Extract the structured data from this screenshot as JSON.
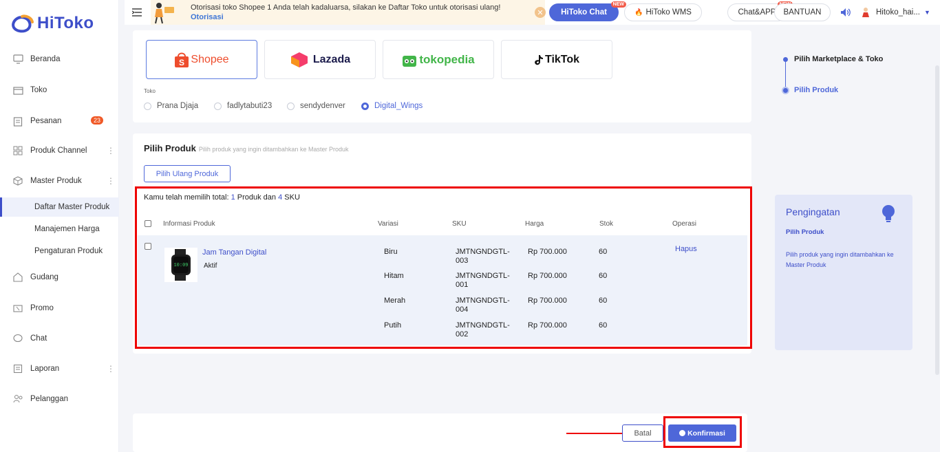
{
  "brand": {
    "name": "HiToko"
  },
  "sidebar": {
    "items": [
      {
        "label": "Beranda"
      },
      {
        "label": "Toko"
      },
      {
        "label": "Pesanan",
        "badge": "23"
      },
      {
        "label": "Produk Channel"
      },
      {
        "label": "Master Produk"
      },
      {
        "label": "Gudang"
      },
      {
        "label": "Promo"
      },
      {
        "label": "Chat"
      },
      {
        "label": "Laporan"
      },
      {
        "label": "Pelanggan"
      }
    ],
    "sub_items": [
      {
        "label": "Daftar Master Produk"
      },
      {
        "label": "Manajemen Harga"
      },
      {
        "label": "Pengaturan Produk"
      }
    ]
  },
  "topbar": {
    "menu_letter": "M",
    "notice_text": "Otorisasi toko Shopee 1 Anda telah kadaluarsa, silakan ke Daftar Toko untuk otorisasi ulang!",
    "notice_link": "Otorisasi",
    "hitoko_chat": "HiToko Chat",
    "new_tag": "NEW",
    "hitoko_wms": "HiToko WMS",
    "chat_app": "Chat&APP",
    "bantuan": "BANTUAN",
    "username": "Hitoko_hai..."
  },
  "marketplaces": [
    {
      "name": "Shopee"
    },
    {
      "name": "Lazada"
    },
    {
      "name": "tokopedia"
    },
    {
      "name": "TikTok"
    }
  ],
  "toko": {
    "label": "Toko",
    "options": [
      "Prana Djaja",
      "fadlytabuti23",
      "sendydenver",
      "Digital_Wings"
    ],
    "selected": "Digital_Wings"
  },
  "pilih_produk": {
    "title": "Pilih Produk",
    "hint": "Pilih produk yang ingin ditambahkan ke Master Produk",
    "reselect_label": "Pilih Ulang Produk",
    "summary_prefix": "Kamu telah memilih total:",
    "summary_products": "1",
    "summary_mid": "Produk dan",
    "summary_sku": "4",
    "summary_suffix": "SKU",
    "columns": [
      "Informasi Produk",
      "Variasi",
      "SKU",
      "Harga",
      "Stok",
      "Operasi"
    ],
    "product": {
      "name": "Jam Tangan Digital",
      "status": "Aktif",
      "operation": "Hapus",
      "variants": [
        {
          "variasi": "Biru",
          "sku": "JMTNGNDGTL-003",
          "harga": "Rp 700.000",
          "stok": "60"
        },
        {
          "variasi": "Hitam",
          "sku": "JMTNGNDGTL-001",
          "harga": "Rp 700.000",
          "stok": "60"
        },
        {
          "variasi": "Merah",
          "sku": "JMTNGNDGTL-004",
          "harga": "Rp 700.000",
          "stok": "60"
        },
        {
          "variasi": "Putih",
          "sku": "JMTNGNDGTL-002",
          "harga": "Rp 700.000",
          "stok": "60"
        }
      ]
    }
  },
  "steps": [
    {
      "label": "Pilih Marketplace & Toko"
    },
    {
      "label": "Pilih Produk"
    }
  ],
  "reminder": {
    "title": "Pengingatan",
    "subtitle": "Pilih Produk",
    "desc": "Pilih produk yang ingin ditambahkan ke Master Produk"
  },
  "footer": {
    "cancel": "Batal",
    "confirm": "Konfirmasi"
  },
  "colors": {
    "primary": "#4e67d9",
    "brand": "#3d4ec9",
    "highlight": "#e00000",
    "badge": "#f05a28"
  }
}
